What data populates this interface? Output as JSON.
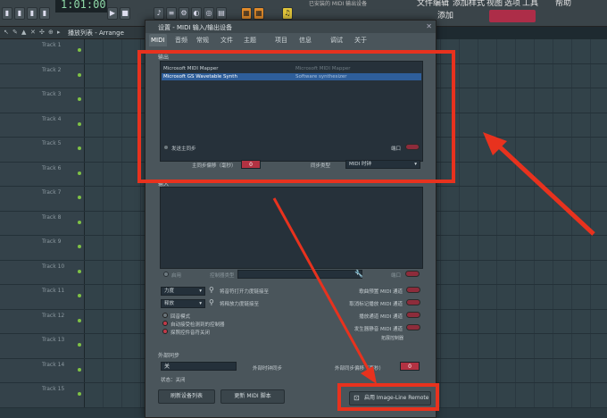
{
  "topbar": {
    "time": "1:01:00",
    "status_text": "已安装的 MIDI 输出设备",
    "add_label": "添加",
    "menus": [
      "文件",
      "编辑",
      "添加",
      "样式",
      "视图",
      "选项",
      "工具",
      "帮助"
    ]
  },
  "playlist": {
    "title": "播放列表 - Arrange",
    "tracks": [
      "Track 1",
      "Track 2",
      "Track 3",
      "Track 4",
      "Track 5",
      "Track 6",
      "Track 7",
      "Track 8",
      "Track 9",
      "Track 10",
      "Track 11",
      "Track 12",
      "Track 13",
      "Track 14",
      "Track 15"
    ]
  },
  "dialog": {
    "title": "设置 - MIDI 输入/输出设备",
    "close_icon": "close-icon",
    "tabs": [
      "MIDI",
      "音频",
      "常规",
      "文件",
      "主题",
      "项目",
      "信息",
      "调试",
      "关于"
    ],
    "active_tab": "MIDI",
    "output": {
      "label": "输出",
      "devices": [
        {
          "name": "Microsoft MIDI Mapper",
          "desc": "Microsoft MIDI Mapper",
          "selected": false
        },
        {
          "name": "Microsoft GS Wavetable Synth",
          "desc": "Software synthesizer",
          "selected": true
        }
      ],
      "send_master_sync": "发送主同步",
      "port_label": "端口",
      "offset_label": "主同步偏移（毫秒）",
      "offset_value": "0",
      "sync_type_label": "同步类型",
      "sync_type_value": "MIDI 时钟"
    },
    "input": {
      "label": "输入",
      "enable_label": "启用",
      "controller_type_label": "控制器类型",
      "port_label": "端口",
      "left_dropdowns": [
        {
          "value": "力度",
          "right": "将音符打开力度链接至"
        },
        {
          "value": "释放",
          "right": "将释放力度链接至"
        }
      ],
      "radios": [
        {
          "label": "回音模式",
          "on": false
        },
        {
          "label": "自动接受检测到的控制器",
          "on": true
        },
        {
          "label": "探照控件音符关闭",
          "on": true
        }
      ],
      "right_items": [
        "歌曲预置 MIDI 通道",
        "取消标记播放 MIDI 通道",
        "播放通道 MIDI 通道",
        "发生器静音 MIDI 通道"
      ],
      "controller_link": "拓展控制器"
    },
    "external_sync": {
      "label": "外部同步",
      "value": "关",
      "tempo_label": "外部时钟同步",
      "offset_label": "外部同步偏移（毫秒）",
      "offset_value": "0",
      "status_label": "状态：关闭"
    },
    "buttons": {
      "refresh": "刷新设备列表",
      "rescan": "更新 MIDI 脚本",
      "enable_remote": "启用 Image-Line Remote"
    }
  },
  "colors": {
    "highlight": "#e8321e",
    "selection": "#2e5e9a",
    "accent_red": "#b33242"
  }
}
